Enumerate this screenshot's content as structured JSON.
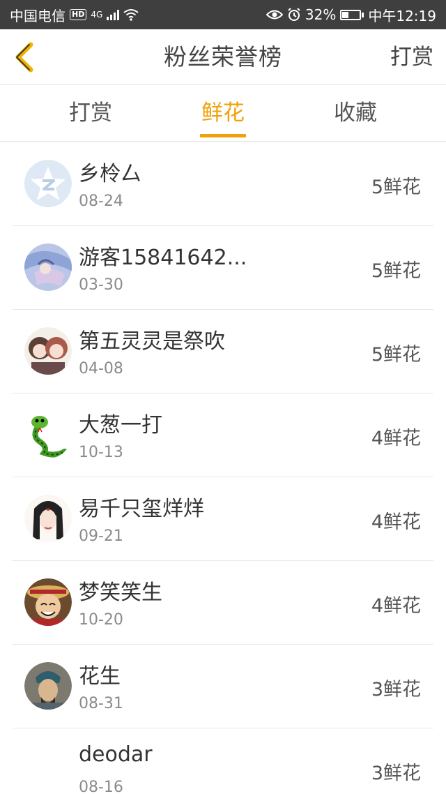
{
  "status_bar": {
    "carrier": "中国电信",
    "network": "4G",
    "battery": "32%",
    "time": "中午12:19"
  },
  "header": {
    "title": "粉丝荣誉榜",
    "action_label": "打赏"
  },
  "tabs": [
    {
      "label": "打赏",
      "active": false
    },
    {
      "label": "鲜花",
      "active": true
    },
    {
      "label": "收藏",
      "active": false
    }
  ],
  "colors": {
    "accent": "#f0a10a",
    "status_bar_bg": "#3f3f3f"
  },
  "list": [
    {
      "name": "乡柃厶",
      "date": "08-24",
      "amount": "5鲜花",
      "avatar": "qq-default-avatar"
    },
    {
      "name": "游客15841642...",
      "date": "03-30",
      "amount": "5鲜花",
      "avatar": "anime-girl-avatar"
    },
    {
      "name": "第五灵灵是祭吹",
      "date": "04-08",
      "amount": "5鲜花",
      "avatar": "two-anime-characters-avatar"
    },
    {
      "name": "大葱一打",
      "date": "10-13",
      "amount": "4鲜花",
      "avatar": "green-snake-avatar"
    },
    {
      "name": "易千只玺烊烊",
      "date": "09-21",
      "amount": "4鲜花",
      "avatar": "ancient-lady-avatar"
    },
    {
      "name": "梦笑笑生",
      "date": "10-20",
      "amount": "4鲜花",
      "avatar": "luffy-avatar"
    },
    {
      "name": "花生",
      "date": "08-31",
      "amount": "3鲜花",
      "avatar": "warrior-avatar"
    },
    {
      "name": "deodar",
      "date": "08-16",
      "amount": "3鲜花",
      "avatar": "blank-avatar"
    }
  ]
}
